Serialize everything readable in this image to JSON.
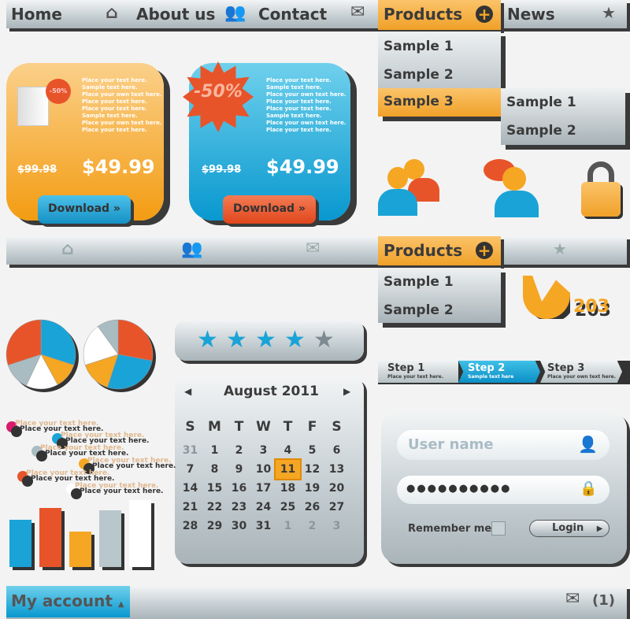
{
  "nav": {
    "home": "Home",
    "about": "About us",
    "contact": "Contact",
    "products": "Products",
    "news": "News",
    "icons": [
      "house-icon",
      "users-icon",
      "envelope-icon",
      "plus-icon",
      "star-icon"
    ]
  },
  "dropdown": {
    "items": [
      "Sample 1",
      "Sample 2",
      "Sample 3"
    ],
    "active": "Sample 3",
    "submenu": [
      "Sample 1",
      "Sample 2"
    ]
  },
  "cards": [
    {
      "color": "#f5a623",
      "badge": "-50%",
      "lines": [
        "Place your  text here.",
        "Sample text here.",
        "Place your own text here.",
        "Place your  text here.",
        "Place your  text here.",
        "Sample text here.",
        "Place your own text here.",
        "Place your  text here."
      ],
      "old_price": "$99.98",
      "price": "$49.99",
      "button": "Download"
    },
    {
      "color": "#1aa3d6",
      "badge": "-50%",
      "lines": [
        "Place your  text here.",
        "Sample text here.",
        "Place your own text here.",
        "Place your  text here.",
        "Place your  text here.",
        "Sample text here.",
        "Place your own text here.",
        "Place your  text here."
      ],
      "old_price": "$99.98",
      "price": "$49.99",
      "button": "Download"
    }
  ],
  "nav2": {
    "products": "Products",
    "dropdown": [
      "Sample 1",
      "Sample 2"
    ]
  },
  "logo": {
    "text": "203"
  },
  "rating": {
    "value": 4,
    "max": 5
  },
  "calendar": {
    "title": "August 2011",
    "days": [
      "S",
      "M",
      "T",
      "W",
      "T",
      "F",
      "S"
    ],
    "weeks": [
      [
        "31",
        "1",
        "2",
        "3",
        "4",
        "5",
        "6"
      ],
      [
        "7",
        "8",
        "9",
        "10",
        "11",
        "12",
        "13"
      ],
      [
        "14",
        "15",
        "16",
        "17",
        "18",
        "19",
        "20"
      ],
      [
        "21",
        "22",
        "23",
        "24",
        "25",
        "26",
        "27"
      ],
      [
        "28",
        "29",
        "30",
        "31",
        "1",
        "2",
        "3"
      ]
    ],
    "selected": "11"
  },
  "steps": [
    {
      "title": "Step 1",
      "sub": "Place your  text here."
    },
    {
      "title": "Step 2",
      "sub": "Sample text here"
    },
    {
      "title": "Step 3",
      "sub": "Place your own text here."
    }
  ],
  "login": {
    "username_placeholder": "User name",
    "password": "●●●●●●●●●●",
    "remember": "Remember me",
    "button": "Login"
  },
  "legend": [
    {
      "color": "#d81b6b",
      "top": "Place your  text here.",
      "bottom": "Place your  text here."
    },
    {
      "color": "#1aa3d6",
      "top": "Place your  text here.",
      "bottom": "Place your  text here."
    },
    {
      "color": "#a9bcc2",
      "top": "Place your  text here.",
      "bottom": "Place your  text here."
    },
    {
      "color": "#f5a623",
      "top": "Place your  text here.",
      "bottom": "Place your  text here."
    },
    {
      "color": "#e8542a",
      "top": "Place your  text here.",
      "bottom": "Place your  text here."
    },
    {
      "color": "#ffffff",
      "top": "Place your  text here.",
      "bottom": "Place your  text here."
    }
  ],
  "bar_chart": {
    "colors": [
      "#1aa3d6",
      "#e8542a",
      "#f5a623",
      "#b8c7cc",
      "#ffffff"
    ],
    "values": [
      60,
      75,
      45,
      72,
      85
    ]
  },
  "pies": [
    {
      "colors": [
        "#1aa3d6",
        "#f5a623",
        "#ffffff",
        "#a9bcc2",
        "#e8542a"
      ],
      "values": [
        30,
        12,
        15,
        13,
        30
      ]
    },
    {
      "colors": [
        "#e8542a",
        "#1aa3d6",
        "#f5a623",
        "#ffffff",
        "#a9bcc2"
      ],
      "values": [
        28,
        27,
        15,
        20,
        10
      ]
    }
  ],
  "footer": {
    "account": "My account",
    "messages": "(1)"
  }
}
